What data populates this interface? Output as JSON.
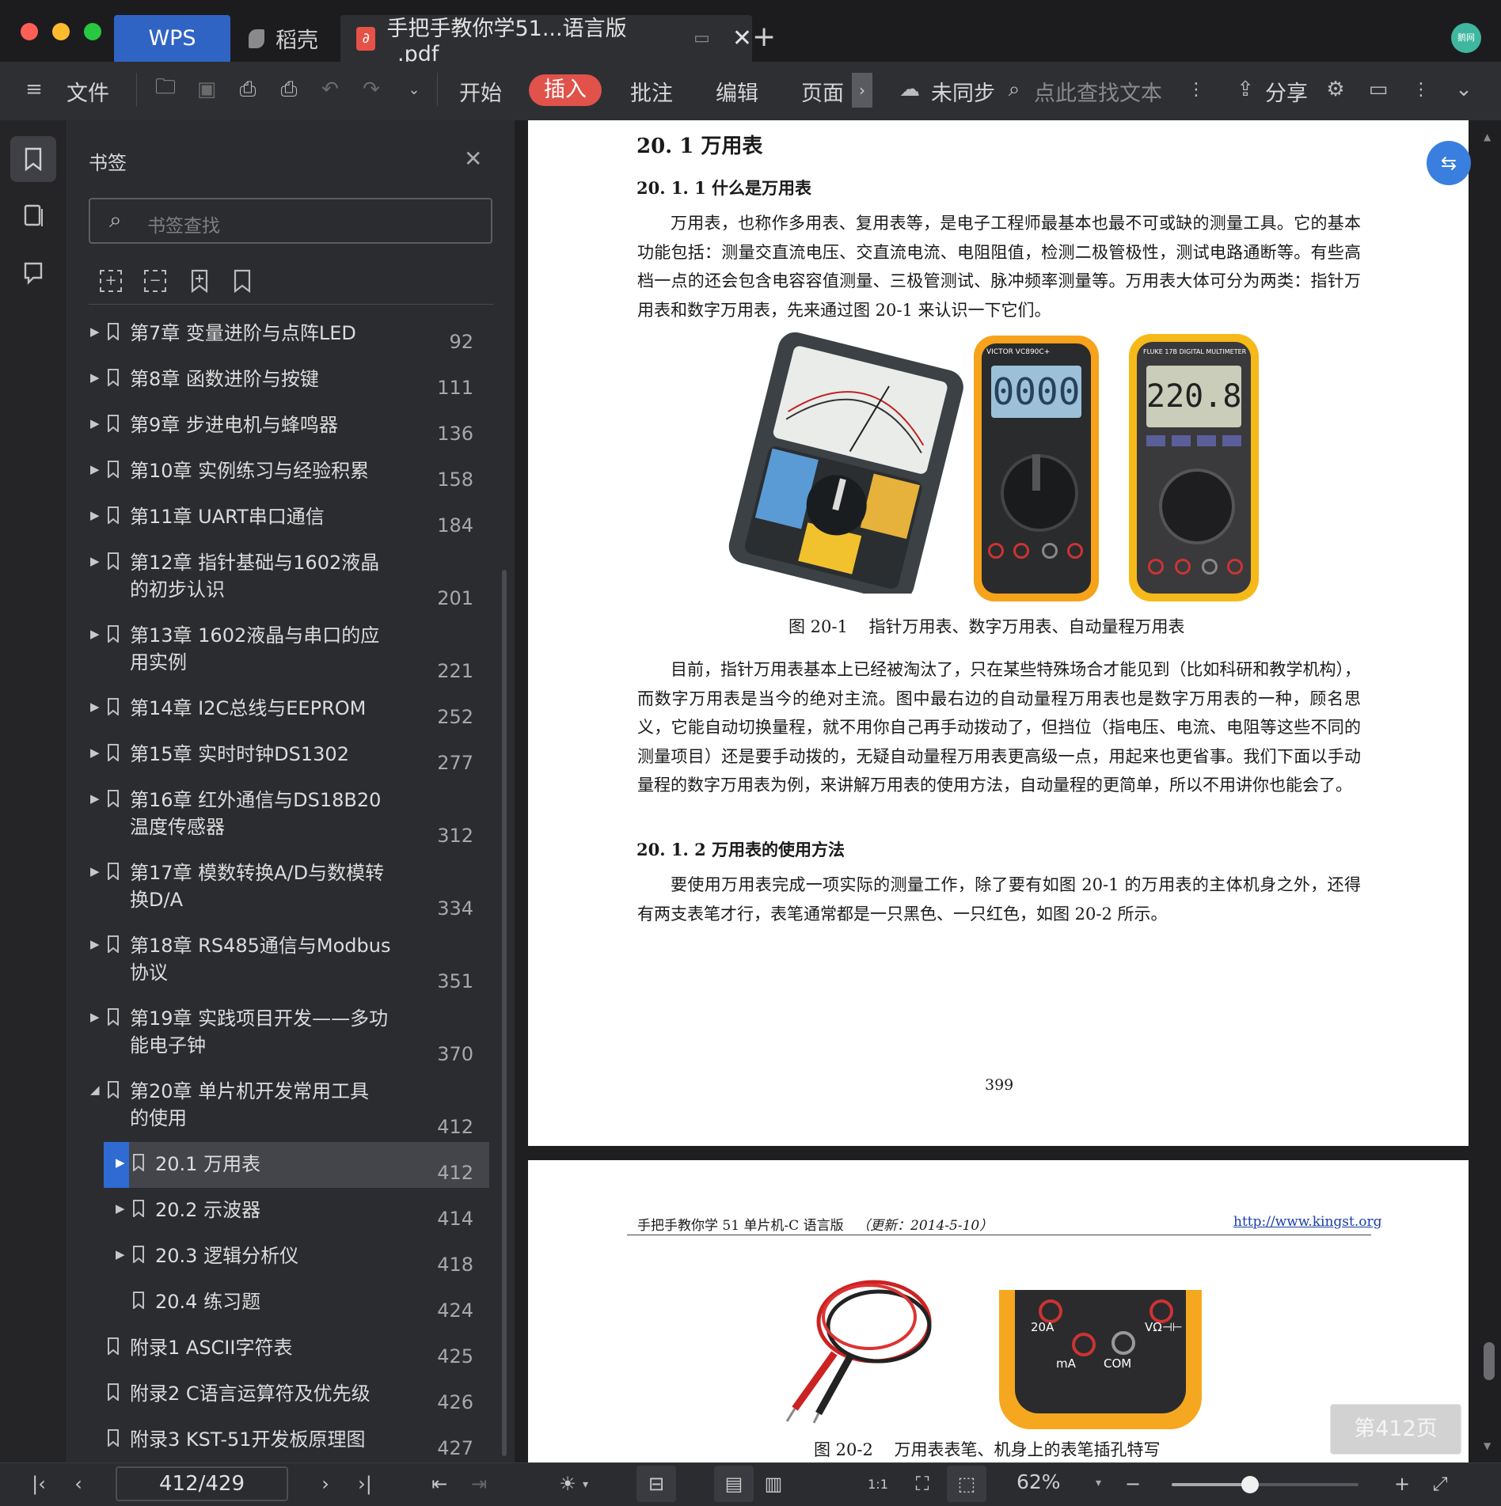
{
  "window": {
    "tabs": [
      {
        "label": "WPS"
      },
      {
        "label": "稻壳"
      },
      {
        "label": "手把手教你学51...语言版_.pdf"
      }
    ],
    "avatar_text": "鹅网"
  },
  "toolbar": {
    "file_label": "文件",
    "menu_start": "开始",
    "menu_insert": "插入",
    "menu_comment": "批注",
    "menu_edit": "编辑",
    "menu_page": "页面",
    "sync_label": "未同步",
    "search_placeholder": "点此查找文本",
    "share_label": "分享",
    "accent_color": "#e0524a"
  },
  "bookmarks": {
    "title": "书签",
    "search_placeholder": "书签查找",
    "items": [
      {
        "label": "第7章  变量进阶与点阵LED",
        "page": "92"
      },
      {
        "label": "第8章  函数进阶与按键",
        "page": "111"
      },
      {
        "label": "第9章  步进电机与蜂鸣器",
        "page": "136"
      },
      {
        "label": "第10章  实例练习与经验积累",
        "page": "158"
      },
      {
        "label": "第11章  UART串口通信",
        "page": "184"
      },
      {
        "label": "第12章  指针基础与1602液晶\n的初步认识",
        "page": "201"
      },
      {
        "label": "第13章  1602液晶与串口的应\n用实例",
        "page": "221"
      },
      {
        "label": "第14章  I2C总线与EEPROM",
        "page": "252"
      },
      {
        "label": "第15章  实时时钟DS1302",
        "page": "277"
      },
      {
        "label": "第16章  红外通信与DS18B20\n温度传感器",
        "page": "312"
      },
      {
        "label": "第17章  模数转换A/D与数模转\n换D/A",
        "page": "334"
      },
      {
        "label": "第18章  RS485通信与Modbus\n协议",
        "page": "351"
      },
      {
        "label": "第19章  实践项目开发——多功\n能电子钟",
        "page": "370"
      },
      {
        "label": "第20章  单片机开发常用工具\n的使用",
        "page": "412"
      },
      {
        "label": "20.1 万用表",
        "page": "412"
      },
      {
        "label": "20.2 示波器",
        "page": "414"
      },
      {
        "label": "20.3 逻辑分析仪",
        "page": "418"
      },
      {
        "label": "20.4 练习题",
        "page": "424"
      },
      {
        "label": "附录1  ASCII字符表",
        "page": "425"
      },
      {
        "label": "附录2  C语言运算符及优先级",
        "page": "426"
      },
      {
        "label": "附录3  KST-51开发板原理图",
        "page": "427"
      }
    ]
  },
  "document": {
    "section_title": "20. 1 万用表",
    "subsection1": "20. 1. 1 什么是万用表",
    "para1": "万用表，也称作多用表、复用表等，是电子工程师最基本也最不可或缺的测量工具。它的基本功能包括：测量交直流电压、交直流电流、电阻阻值，检测二极管极性，测试电路通断等。有些高档一点的还会包含电容容值测量、三极管测试、脉冲频率测量等。万用表大体可分为两类：指针万用表和数字万用表，先来通过图 20-1 来认识一下它们。",
    "figure1_caption": "图 20-1    指针万用表、数字万用表、自动量程万用表",
    "meter2_display": "0000",
    "meter2_brand": "VICTOR VC890C+",
    "meter3_display": "220.8",
    "meter3_brand": "FLUKE 17B DIGITAL MULTIMETER",
    "para2": "目前，指针万用表基本上已经被淘汰了，只在某些特殊场合才能见到（比如科研和教学机构），而数字万用表是当今的绝对主流。图中最右边的自动量程万用表也是数字万用表的一种，顾名思义，它能自动切换量程，就不用你自己再手动拨动了，但挡位（指电压、电流、电阻等这些不同的测量项目）还是要手动拨的，无疑自动量程万用表更高级一点，用起来也更省事。我们下面以手动量程的数字万用表为例，来讲解万用表的使用方法，自动量程的更简单，所以不用讲你也能会了。",
    "subsection2": "20. 1. 2 万用表的使用方法",
    "para3": "要使用万用表完成一项实际的测量工作，除了要有如图 20-1 的万用表的主体机身之外，还得有两支表笔才行，表笔通常都是一只黑色、一只红色，如图 20-2 所示。",
    "page_number": "399",
    "header_left": "手把手教你学 51 单片机-C 语言版",
    "header_update": "（更新：2014-5-10）",
    "header_link": "http://www.kingst.org",
    "figure2_caption": "图 20-2    万用表表笔、机身上的表笔插孔特写",
    "jack_labels": [
      "20A",
      "mA",
      "COM",
      "VΩ⊣⊢"
    ],
    "page_badge": "第412页"
  },
  "statusbar": {
    "page_indicator": "412/429",
    "zoom": "62%",
    "zoom_level": 0.42
  }
}
